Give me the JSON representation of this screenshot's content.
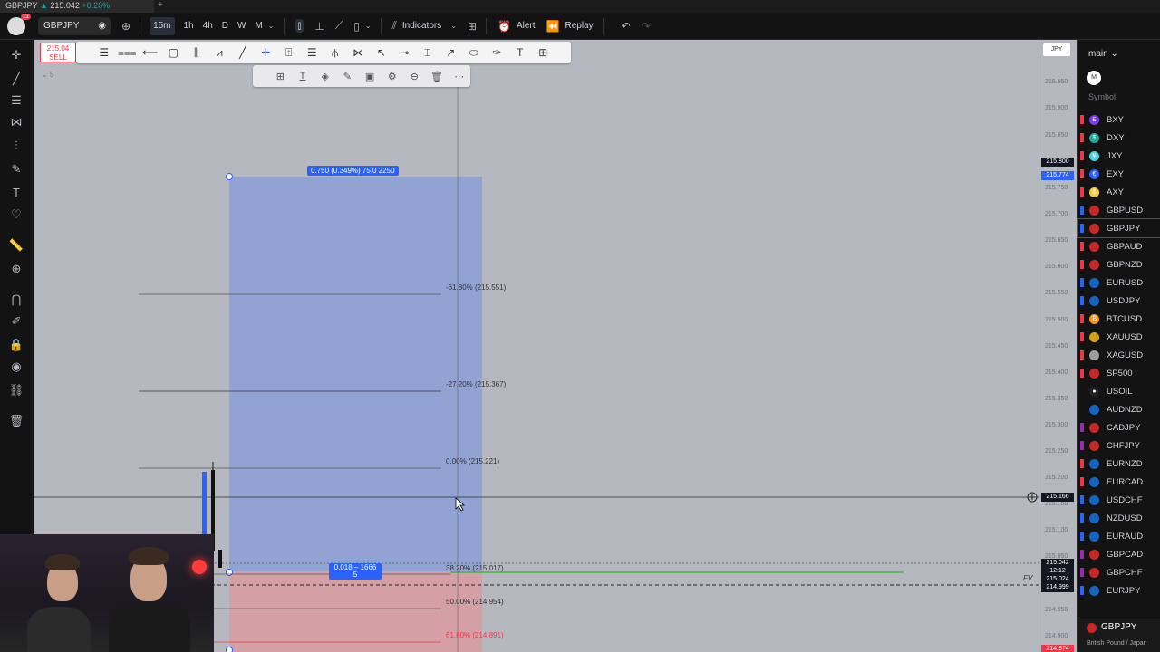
{
  "browser_tab": {
    "title": "GBPJPY",
    "price": "215.042",
    "change": "+0.26%"
  },
  "topbar": {
    "notifications": "11",
    "symbol": "GBPJPY",
    "intervals": [
      "15m",
      "1h",
      "4h",
      "D",
      "W",
      "M"
    ],
    "active_interval": "15m",
    "indicators_label": "Indicators",
    "alert_label": "Alert",
    "replay_label": "Replay"
  },
  "sell_box": {
    "price": "215.04",
    "label": "SELL"
  },
  "small_label": "5",
  "chart": {
    "top_label": "0.750 (0.349%) 75.0 2250",
    "bottom_label_1": "0.018 – 1666",
    "bottom_label_2": "5",
    "fib_levels": [
      {
        "label": "-61.80% (215.551)",
        "color": "#444"
      },
      {
        "label": "-27.20% (215.367)",
        "color": "#444"
      },
      {
        "label": "0.00% (215.221)",
        "color": "#444"
      },
      {
        "label": "38.20% (215.017)",
        "color": "#444"
      },
      {
        "label": "50.00% (214.954)",
        "color": "#444"
      },
      {
        "label": "61.80% (214.891)",
        "color": "#f23645"
      }
    ],
    "fv_label": "FV"
  },
  "price_scale": {
    "currency": "JPY",
    "ticks": [
      "215.950",
      "215.900",
      "215.850",
      "215.750",
      "215.700",
      "215.650",
      "215.600",
      "215.550",
      "215.500",
      "215.450",
      "215.400",
      "215.350",
      "215.300",
      "215.250",
      "215.200",
      "215.150",
      "215.100",
      "215.050",
      "214.950",
      "214.900"
    ],
    "tags": [
      {
        "text": "215.800",
        "bg": "#131722"
      },
      {
        "text": "215.774",
        "bg": "#2962ff"
      },
      {
        "text": "215.166",
        "bg": "#131722"
      },
      {
        "text": "215.042",
        "bg": "#131722"
      },
      {
        "text": "12:12",
        "bg": "#131722"
      },
      {
        "text": "215.024",
        "bg": "#131722"
      },
      {
        "text": "214.999",
        "bg": "#131722"
      },
      {
        "text": "214.874",
        "bg": "#f23645"
      }
    ]
  },
  "watchlist": {
    "title": "main",
    "avatar": "M",
    "column": "Symbol",
    "items": [
      {
        "symbol": "BXY",
        "flag": "#f23645",
        "icon_bg": "#7b3fe4",
        "glyph": "£"
      },
      {
        "symbol": "DXY",
        "flag": "#f23645",
        "icon_bg": "#26a69a",
        "glyph": "$"
      },
      {
        "symbol": "JXY",
        "flag": "#f23645",
        "icon_bg": "#4dd0e1",
        "glyph": "¥"
      },
      {
        "symbol": "EXY",
        "flag": "#f23645",
        "icon_bg": "#2962ff",
        "glyph": "€"
      },
      {
        "symbol": "AXY",
        "flag": "#f23645",
        "icon_bg": "#f2c94c",
        "glyph": "$"
      },
      {
        "symbol": "GBPUSD",
        "flag": "#2962ff",
        "icon_bg": "#c62828",
        "glyph": ""
      },
      {
        "symbol": "GBPJPY",
        "flag": "#2962ff",
        "icon_bg": "#c62828",
        "glyph": ""
      },
      {
        "symbol": "GBPAUD",
        "flag": "#f23645",
        "icon_bg": "#c62828",
        "glyph": ""
      },
      {
        "symbol": "GBPNZD",
        "flag": "#f23645",
        "icon_bg": "#c62828",
        "glyph": ""
      },
      {
        "symbol": "EURUSD",
        "flag": "#2962ff",
        "icon_bg": "#1565c0",
        "glyph": ""
      },
      {
        "symbol": "USDJPY",
        "flag": "#2962ff",
        "icon_bg": "#1565c0",
        "glyph": ""
      },
      {
        "symbol": "BTCUSD",
        "flag": "#f23645",
        "icon_bg": "#f7931a",
        "glyph": "₿"
      },
      {
        "symbol": "XAUUSD",
        "flag": "#f23645",
        "icon_bg": "#d4a017",
        "glyph": ""
      },
      {
        "symbol": "XAGUSD",
        "flag": "#f23645",
        "icon_bg": "#9e9e9e",
        "glyph": ""
      },
      {
        "symbol": "SP500",
        "flag": "#f23645",
        "icon_bg": "#c62828",
        "glyph": ""
      },
      {
        "symbol": "USOIL",
        "flag": "#131313",
        "icon_bg": "#222",
        "glyph": "●"
      },
      {
        "symbol": "AUDNZD",
        "flag": "#131313",
        "icon_bg": "#1565c0",
        "glyph": ""
      },
      {
        "symbol": "CADJPY",
        "flag": "#9c27b0",
        "icon_bg": "#c62828",
        "glyph": ""
      },
      {
        "symbol": "CHFJPY",
        "flag": "#9c27b0",
        "icon_bg": "#c62828",
        "glyph": ""
      },
      {
        "symbol": "EURNZD",
        "flag": "#f23645",
        "icon_bg": "#1565c0",
        "glyph": ""
      },
      {
        "symbol": "EURCAD",
        "flag": "#f23645",
        "icon_bg": "#1565c0",
        "glyph": ""
      },
      {
        "symbol": "USDCHF",
        "flag": "#2962ff",
        "icon_bg": "#1565c0",
        "glyph": ""
      },
      {
        "symbol": "NZDUSD",
        "flag": "#2962ff",
        "icon_bg": "#1565c0",
        "glyph": ""
      },
      {
        "symbol": "EURAUD",
        "flag": "#2962ff",
        "icon_bg": "#1565c0",
        "glyph": ""
      },
      {
        "symbol": "GBPCAD",
        "flag": "#9c27b0",
        "icon_bg": "#c62828",
        "glyph": ""
      },
      {
        "symbol": "GBPCHF",
        "flag": "#9c27b0",
        "icon_bg": "#c62828",
        "glyph": ""
      },
      {
        "symbol": "EURJPY",
        "flag": "#2962ff",
        "icon_bg": "#1565c0",
        "glyph": ""
      }
    ],
    "selected": "GBPJPY",
    "footer_symbol": "GBPJPY",
    "footer_desc": "British Pound / Japan"
  }
}
